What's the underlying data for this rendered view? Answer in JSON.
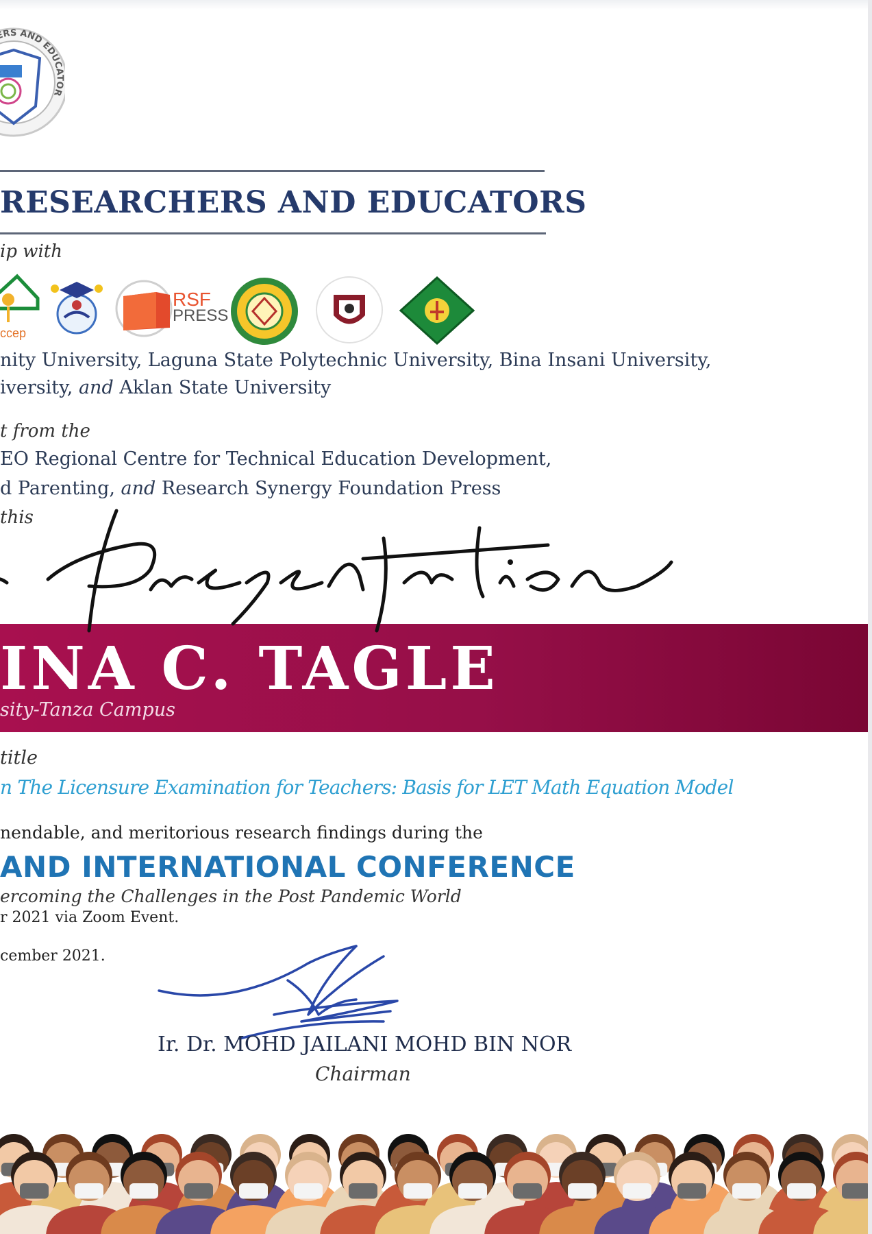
{
  "organization": {
    "seal_text": "RESEARCHERS AND EDUCATORS, Inc.",
    "name": "RESEARCHERS AND EDUCATORS"
  },
  "partnership": {
    "intro": "ip with",
    "logo_rsf_line1": "RSF",
    "logo_rsf_line2": "PRESS",
    "universities_line1": "nity University, Laguna State Polytechnic University, Bina Insani University,",
    "universities_line2_a": "iversity, ",
    "universities_line2_and": "and",
    "universities_line2_b": " Aklan State University"
  },
  "support": {
    "intro": "t from the",
    "line1": "EO Regional Centre for Technical Education Development,",
    "line2_a": "d Parenting, ",
    "line2_and": "and",
    "line2_b": " Research Synergy Foundation Press",
    "lead": "this"
  },
  "certificate": {
    "script_title": "Presentation",
    "recipient": "INA C. TAGLE",
    "campus": "sity-Tanza Campus"
  },
  "paper": {
    "label": "title",
    "title": "n The Licensure Examination for Teachers: Basis for LET Math Equation Model"
  },
  "recognition": {
    "text": "nendable, and meritorious research findings during the",
    "conference": "AND INTERNATIONAL CONFERENCE",
    "theme": "ercoming the Challenges in the Post Pandemic World",
    "venue": "r 2021 via Zoom Event.",
    "given": "cember 2021."
  },
  "signatory": {
    "name": "Ir. Dr. MOHD JAILANI MOHD BIN NOR",
    "role": "Chairman"
  },
  "colors": {
    "navy": "#253a6b",
    "band": "#960f48",
    "accent_blue": "#1f74b4",
    "title_blue": "#2e9fd1",
    "signature_blue": "#2947a8"
  }
}
